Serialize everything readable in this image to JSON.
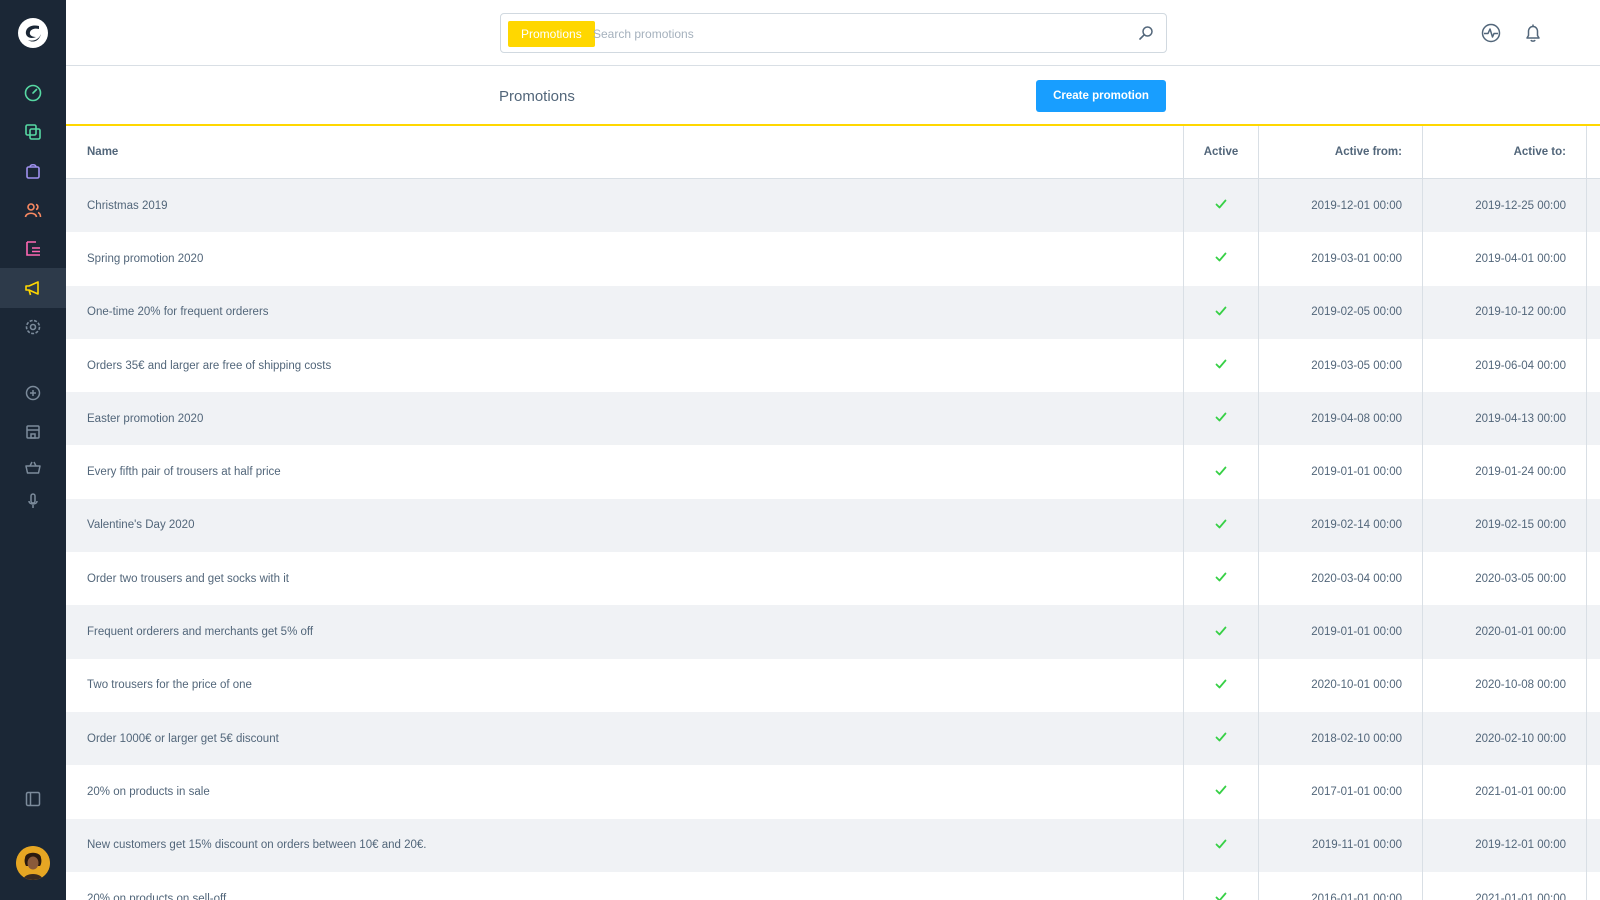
{
  "header": {
    "search_tag": "Promotions",
    "search_placeholder": "Search promotions"
  },
  "smartbar": {
    "title": "Promotions",
    "create_label": "Create promotion"
  },
  "table": {
    "columns": [
      "Name",
      "Active",
      "Active from:",
      "Active to:",
      "···"
    ],
    "rows": [
      {
        "name": "Christmas 2019",
        "active": true,
        "from": "2019-12-01 00:00",
        "to": "2019-12-25 00:00"
      },
      {
        "name": "Spring promotion 2020",
        "active": true,
        "from": "2019-03-01 00:00",
        "to": "2019-04-01 00:00"
      },
      {
        "name": "One-time 20% for frequent orderers",
        "active": true,
        "from": "2019-02-05 00:00",
        "to": "2019-10-12 00:00"
      },
      {
        "name": "Orders 35€ and larger are free of shipping costs",
        "active": true,
        "from": "2019-03-05 00:00",
        "to": "2019-06-04 00:00"
      },
      {
        "name": "Easter promotion 2020",
        "active": true,
        "from": "2019-04-08 00:00",
        "to": "2019-04-13 00:00"
      },
      {
        "name": "Every fifth pair of trousers at half price",
        "active": true,
        "from": "2019-01-01 00:00",
        "to": "2019-01-24 00:00"
      },
      {
        "name": "Valentine's Day 2020",
        "active": true,
        "from": "2019-02-14 00:00",
        "to": "2019-02-15 00:00"
      },
      {
        "name": "Order two trousers and get socks with it",
        "active": true,
        "from": "2020-03-04 00:00",
        "to": "2020-03-05 00:00"
      },
      {
        "name": "Frequent orderers and merchants get 5% off",
        "active": true,
        "from": "2019-01-01 00:00",
        "to": "2020-01-01 00:00"
      },
      {
        "name": "Two trousers for the price of one",
        "active": true,
        "from": "2020-10-01 00:00",
        "to": "2020-10-08 00:00"
      },
      {
        "name": "Order 1000€ or larger get 5€ discount",
        "active": true,
        "from": "2018-02-10 00:00",
        "to": "2020-02-10 00:00"
      },
      {
        "name": "20% on products in sale",
        "active": true,
        "from": "2017-01-01 00:00",
        "to": "2021-01-01 00:00"
      },
      {
        "name": "New customers get 15% discount on orders between 10€ and 20€.",
        "active": true,
        "from": "2019-11-01 00:00",
        "to": "2019-12-01 00:00"
      },
      {
        "name": "20% on products on sell-off",
        "active": true,
        "from": "2016-01-01 00:00",
        "to": "2021-01-01 00:00"
      }
    ],
    "row_action": "···"
  },
  "colors": {
    "sidebar": "#1b2736",
    "accent_yellow": "#ffd700",
    "primary_blue": "#189eff",
    "check_green": "#37d046"
  },
  "icons": {
    "sidebar": [
      "dashboard-icon",
      "products-icon",
      "orders-icon",
      "customers-icon",
      "content-icon",
      "marketing-icon",
      "settings-icon",
      "add-icon",
      "storefront-icon",
      "basket-icon",
      "microphone-icon",
      "collapse-sidebar-icon"
    ],
    "header": [
      "search-icon",
      "activity-icon",
      "bell-icon"
    ]
  }
}
